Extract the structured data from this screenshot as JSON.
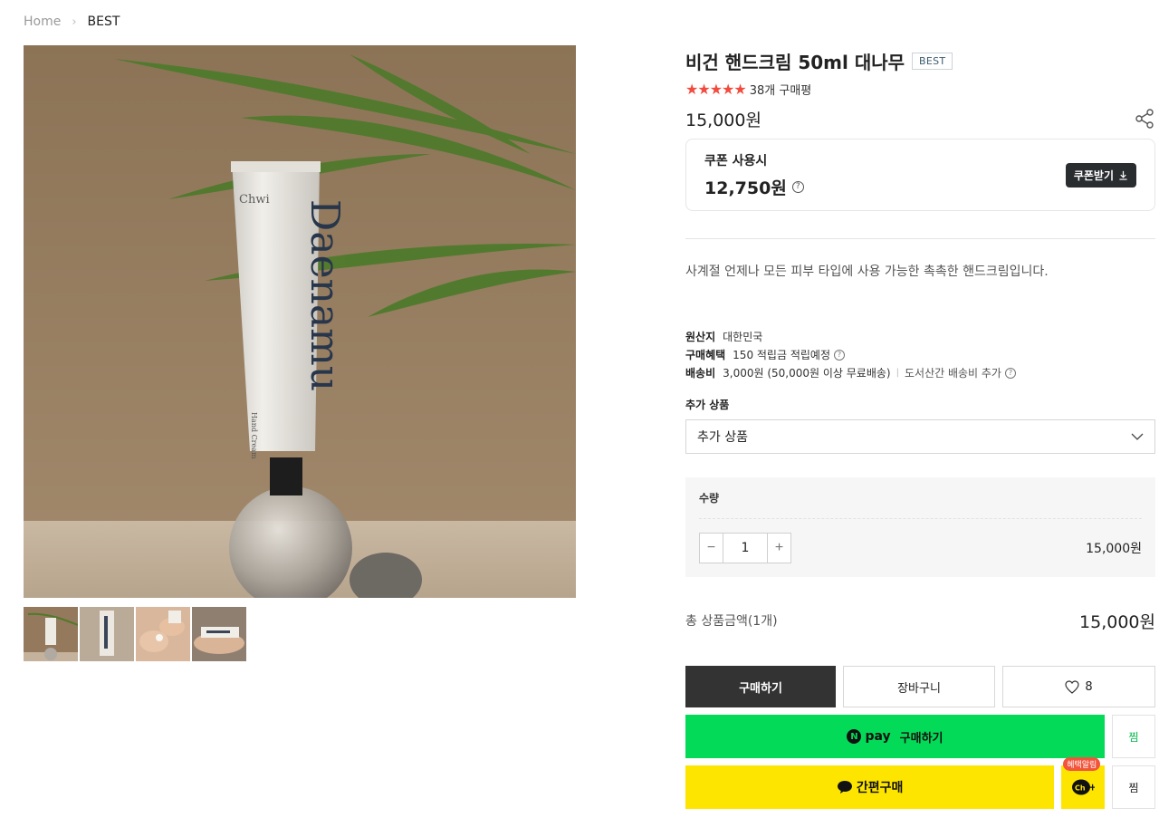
{
  "breadcrumb": {
    "home": "Home",
    "current": "BEST"
  },
  "product": {
    "title": "비건 핸드크림 50ml 대나무",
    "badge": "BEST",
    "rating_stars": 5,
    "review_count": "38개 구매평",
    "price": "15,000원",
    "tube_brand": "Chwi",
    "tube_name": "Daenamu",
    "tube_sub": "Hand Cream"
  },
  "coupon": {
    "label": "쿠폰 사용시",
    "price": "12,750원",
    "button": "쿠폰받기"
  },
  "description": "사계절 언제나 모든 피부 타입에 사용 가능한 촉촉한 핸드크림입니다.",
  "meta": {
    "origin_key": "원산지",
    "origin_value": "대한민국",
    "benefit_key": "구매혜택",
    "benefit_value": "150 적립금 적립예정",
    "shipping_key": "배송비",
    "shipping_value": "3,000원 (50,000원 이상 무료배송)",
    "shipping_extra": "도서산간 배송비 추가"
  },
  "addon": {
    "title": "추가 상품",
    "select_value": "추가 상품"
  },
  "quantity": {
    "label": "수량",
    "value": "1",
    "price": "15,000원"
  },
  "total": {
    "label": "총 상품금액(1개)",
    "price": "15,000원"
  },
  "buttons": {
    "buy": "구매하기",
    "cart": "장바구니",
    "wish_count": "8",
    "npay_n": "N",
    "npay_pay": "pay",
    "npay_label": "구매하기",
    "zzim": "찜",
    "kakao": "간편구매",
    "ch_badge": "혜택알림",
    "ch_label": "Ch+"
  },
  "colors": {
    "star": "#f24b3d",
    "buy_button": "#333333",
    "npay": "#03db58",
    "kakao": "#fee500",
    "coupon_button": "#2a2d30"
  }
}
